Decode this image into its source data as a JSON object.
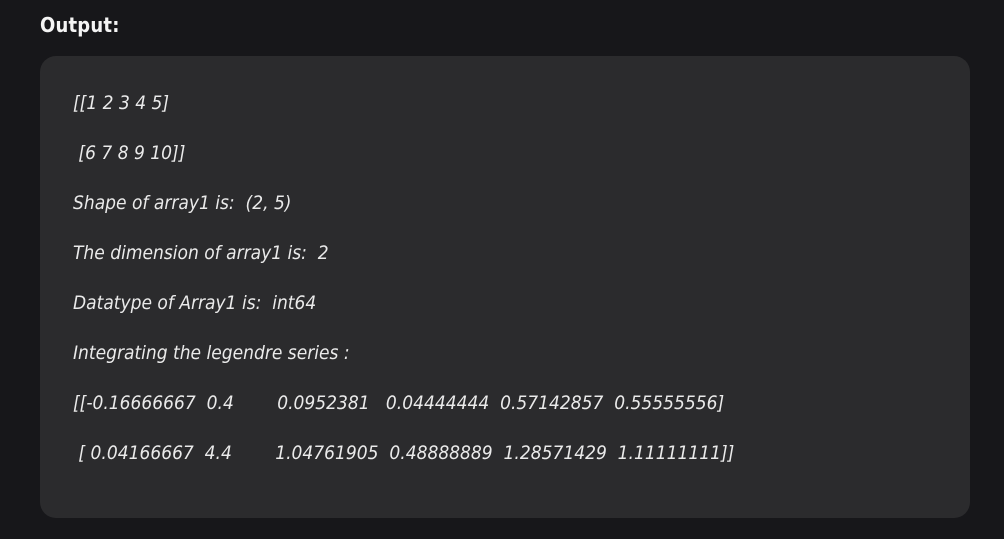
{
  "heading": "Output:",
  "output_lines": [
    "[[1 2 3 4 5]",
    " [6 7 8 9 10]]",
    "Shape of array1 is:  (2, 5)",
    "The dimension of array1 is:  2",
    "Datatype of Array1 is:  int64",
    "Integrating the legendre series :",
    "[[-0.16666667  0.4        0.0952381   0.04444444  0.57142857  0.55555556]",
    " [ 0.04166667  4.4        1.04761905  0.48888889  1.28571429  1.11111111]]"
  ]
}
